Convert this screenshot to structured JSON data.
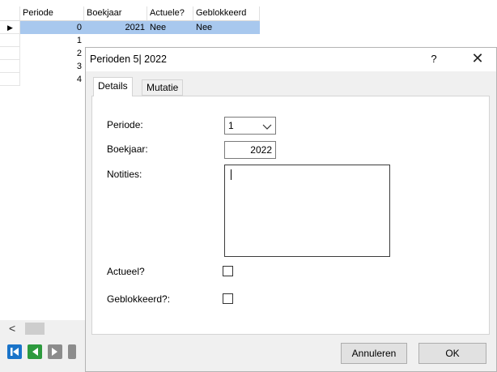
{
  "grid": {
    "columns": [
      "Periode",
      "Boekjaar",
      "Actuele?",
      "Geblokkeerd"
    ],
    "rows": [
      {
        "periode": "0",
        "boekjaar": "2021",
        "actuele": "Nee",
        "geblokkeerd": "Nee",
        "selected": true
      },
      {
        "periode": "1"
      },
      {
        "periode": "2"
      },
      {
        "periode": "3"
      },
      {
        "periode": "4"
      }
    ],
    "current_row_indicator": "▶",
    "scroll_left_arrow": "<"
  },
  "navigator": {
    "buttons": [
      "first-record",
      "previous-record",
      "next-record",
      "last-record"
    ],
    "color": "#1a74c9"
  },
  "dialog": {
    "title": "Perioden 5| 2022",
    "help": "?",
    "close": "✕",
    "tabs": [
      {
        "label": "Details",
        "active": true
      },
      {
        "label": "Mutatie",
        "active": false
      }
    ],
    "fields": {
      "periode_label": "Periode:",
      "periode_value": "1",
      "boekjaar_label": "Boekjaar:",
      "boekjaar_value": "2022",
      "notities_label": "Notities:",
      "notities_value": "",
      "actueel_label": "Actueel?",
      "actueel_checked": false,
      "geblokkeerd_label": "Geblokkeerd?:",
      "geblokkeerd_checked": false
    },
    "buttons": {
      "cancel": "Annuleren",
      "ok": "OK"
    }
  },
  "colors": {
    "selection": "#a8c8ee",
    "dialog_bg": "#f0f0f0"
  }
}
